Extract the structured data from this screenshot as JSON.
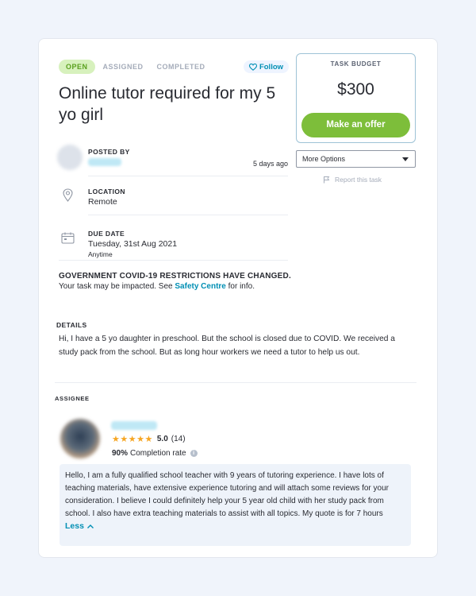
{
  "task": {
    "status_steps": [
      "OPEN",
      "ASSIGNED",
      "COMPLETED"
    ],
    "follow_label": "Follow",
    "title": "Online tutor required for my 5 yo girl",
    "posted_by_label": "POSTED BY",
    "posted_ago": "5 days ago",
    "location_label": "LOCATION",
    "location_value": "Remote",
    "due_label": "DUE DATE",
    "due_value": "Tuesday, 31st Aug 2021",
    "due_sub": "Anytime",
    "covid_title": "GOVERNMENT COVID-19 RESTRICTIONS HAVE CHANGED.",
    "covid_text_before": "Your task may be impacted. See ",
    "covid_link": "Safety Centre",
    "covid_text_after": " for info.",
    "details_label": "DETAILS",
    "details_text": "Hi, I have a 5 yo daughter in preschool. But the school is closed due to COVID. We received a study pack from the school. But as long hour workers we need a tutor to help us out."
  },
  "assignee": {
    "label": "ASSIGNEE",
    "rating": "5.0",
    "review_count": "(14)",
    "completion_pct": "90%",
    "completion_label": "Completion rate",
    "info_glyph": "i",
    "bio": "Hello, I am a fully qualified school teacher with 9 years of tutoring experience. I have lots of teaching materials, have extensive experience tutoring and will attach some reviews for your consideration. I believe I could definitely help your 5 year old child with her study pack from school. I also have extra teaching materials to assist with all topics. My quote is for 7 hours",
    "less_label": "Less"
  },
  "sidebar": {
    "budget_label": "TASK BUDGET",
    "budget_amount": "$300",
    "offer_button": "Make an offer",
    "more_options": "More Options",
    "report_label": "Report this task"
  },
  "colors": {
    "accent": "#008fb4",
    "offer_green": "#7dbe3a",
    "open_pill_bg": "#d7f1bd",
    "open_pill_text": "#5aa01e",
    "star": "#f6a623"
  },
  "icons": [
    "heart-outline-icon",
    "location-pin-icon",
    "calendar-icon",
    "star-icon",
    "info-icon",
    "chevron-up-icon",
    "caret-down-icon",
    "flag-icon"
  ]
}
